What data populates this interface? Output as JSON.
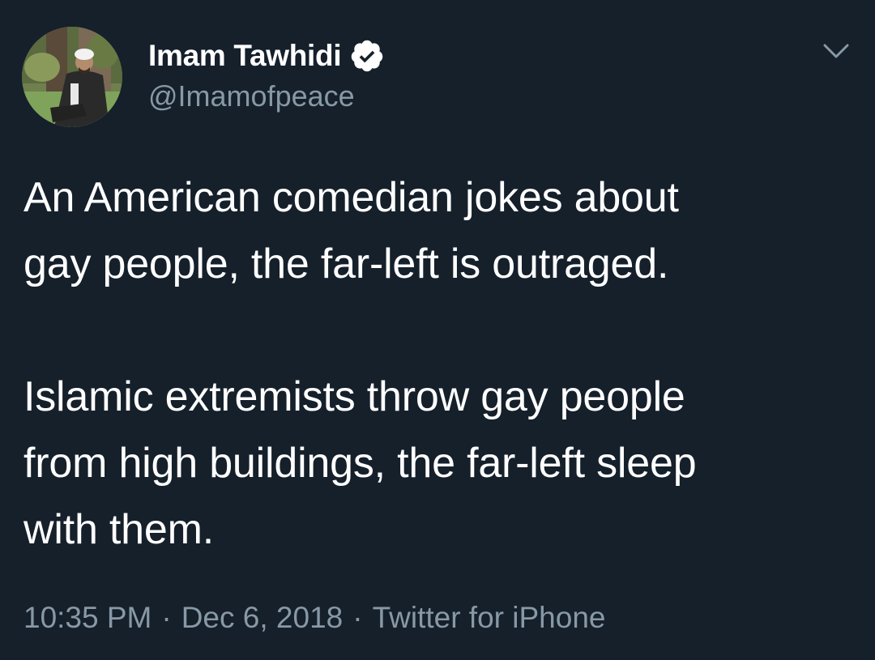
{
  "author": {
    "display_name": "Imam Tawhidi",
    "handle": "@Imamofpeace",
    "verified": true
  },
  "tweet": {
    "lines_para1": [
      "An American comedian jokes about",
      "gay people, the far-left is outraged."
    ],
    "lines_para2": [
      "Islamic extremists throw gay people",
      "from high buildings, the far-left sleep",
      "with them."
    ]
  },
  "meta": {
    "time": "10:35 PM",
    "date": "Dec 6, 2018",
    "source": "Twitter for iPhone",
    "separator": "·"
  },
  "icons": {
    "verified": "verified-badge-icon",
    "menu": "chevron-down-icon"
  },
  "colors": {
    "background": "#15202b",
    "text_primary": "#ffffff",
    "text_secondary": "#8899a6",
    "verified_badge": "#ffffff"
  }
}
